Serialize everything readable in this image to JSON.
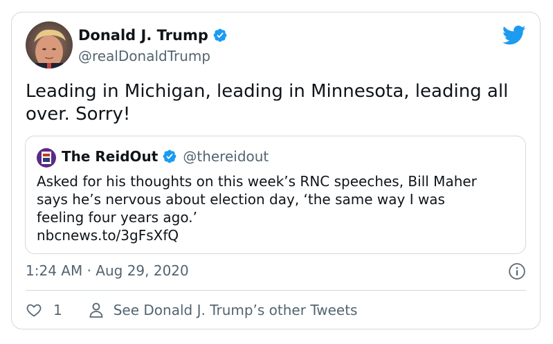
{
  "tweet": {
    "author": {
      "name": "Donald J. Trump",
      "handle": "@realDonaldTrump",
      "verified": true,
      "avatar": "profile-photo"
    },
    "text": "Leading in Michigan, leading in Minnesota, leading all over. Sorry!",
    "quoted_tweet": {
      "author": {
        "name": "The ReidOut",
        "handle": "@thereidout",
        "verified": true,
        "avatar": "reidout-logo"
      },
      "text_lines": [
        "Asked for his thoughts on this week’s RNC speeches, Bill Maher",
        "says he’s nervous about election day, ‘the same way I was",
        "feeling four years ago.’",
        "nbcnews.to/3gFsXfQ"
      ]
    },
    "timestamp": "1:24 AM · Aug 29, 2020",
    "likes": "1",
    "other_tweets_label": "See Donald J. Trump’s other Tweets"
  },
  "icons": {
    "brand": "twitter-bird-icon",
    "verified": "verified-badge-icon",
    "info": "info-icon",
    "like": "heart-icon",
    "profile": "person-icon"
  },
  "colors": {
    "twitter_blue": "#1d9bf0",
    "text": "#0f1419",
    "secondary_text": "#536471",
    "border": "#cfd9de"
  }
}
